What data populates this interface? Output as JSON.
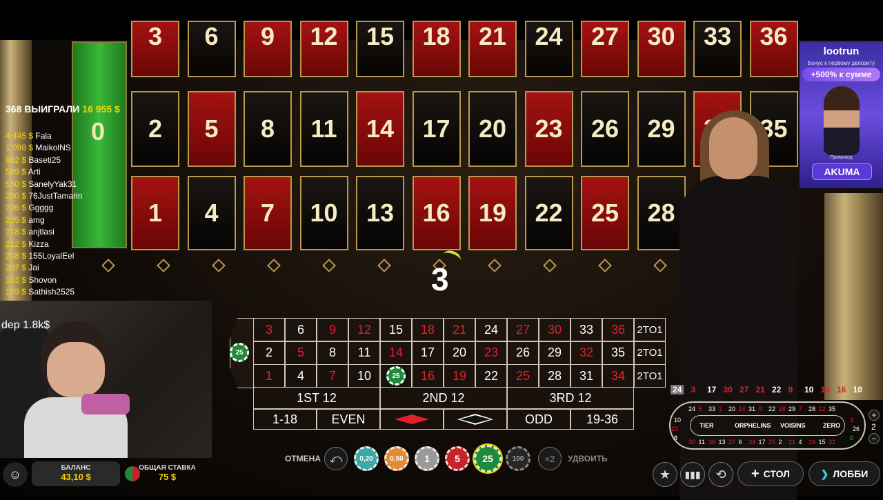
{
  "wall": {
    "zero": "0",
    "top_row": [
      {
        "n": "3",
        "c": "red"
      },
      {
        "n": "6",
        "c": "black"
      },
      {
        "n": "9",
        "c": "red"
      },
      {
        "n": "12",
        "c": "red"
      },
      {
        "n": "15",
        "c": "black"
      },
      {
        "n": "18",
        "c": "red"
      },
      {
        "n": "21",
        "c": "red"
      },
      {
        "n": "24",
        "c": "black"
      },
      {
        "n": "27",
        "c": "red"
      },
      {
        "n": "30",
        "c": "red"
      },
      {
        "n": "33",
        "c": "black"
      },
      {
        "n": "36",
        "c": "red"
      }
    ],
    "mid_row": [
      {
        "n": "2",
        "c": "black"
      },
      {
        "n": "5",
        "c": "red"
      },
      {
        "n": "8",
        "c": "black"
      },
      {
        "n": "11",
        "c": "black"
      },
      {
        "n": "14",
        "c": "red"
      },
      {
        "n": "17",
        "c": "black"
      },
      {
        "n": "20",
        "c": "black"
      },
      {
        "n": "23",
        "c": "red"
      },
      {
        "n": "26",
        "c": "black"
      },
      {
        "n": "29",
        "c": "black"
      },
      {
        "n": "32",
        "c": "red"
      },
      {
        "n": "35",
        "c": "black"
      }
    ],
    "bot_row": [
      {
        "n": "1",
        "c": "red"
      },
      {
        "n": "4",
        "c": "black"
      },
      {
        "n": "7",
        "c": "red"
      },
      {
        "n": "10",
        "c": "black"
      },
      {
        "n": "13",
        "c": "black"
      },
      {
        "n": "16",
        "c": "red"
      },
      {
        "n": "19",
        "c": "red"
      },
      {
        "n": "22",
        "c": "black"
      },
      {
        "n": "25",
        "c": "red"
      },
      {
        "n": "28",
        "c": "black"
      }
    ]
  },
  "result_number": "3",
  "winners": {
    "count": "368",
    "label": "ВЫИГРАЛИ",
    "total": "16 955 $",
    "list": [
      {
        "amount": "4 445 $",
        "name": "Fala"
      },
      {
        "amount": "1 098 $",
        "name": "MaikolNS"
      },
      {
        "amount": "962 $",
        "name": "Baseti25"
      },
      {
        "amount": "589 $",
        "name": "Arti"
      },
      {
        "amount": "550 $",
        "name": "SanelyYak31"
      },
      {
        "amount": "280 $",
        "name": "76JustTamarin"
      },
      {
        "amount": "226 $",
        "name": "Ggggg"
      },
      {
        "amount": "225 $",
        "name": "amg"
      },
      {
        "amount": "218 $",
        "name": "anjtlasi"
      },
      {
        "amount": "212 $",
        "name": "Kizza"
      },
      {
        "amount": "208 $",
        "name": "155LoyalEel"
      },
      {
        "amount": "207 $",
        "name": "Jai"
      },
      {
        "amount": "163 $",
        "name": "Shovon"
      },
      {
        "amount": "159 $",
        "name": "Sathish2525"
      }
    ]
  },
  "bet_table": {
    "zero_chip": "25",
    "rows": [
      [
        {
          "n": "3",
          "c": "r"
        },
        {
          "n": "6",
          "c": "b"
        },
        {
          "n": "9",
          "c": "r"
        },
        {
          "n": "12",
          "c": "r"
        },
        {
          "n": "15",
          "c": "b"
        },
        {
          "n": "18",
          "c": "r"
        },
        {
          "n": "21",
          "c": "r"
        },
        {
          "n": "24",
          "c": "b"
        },
        {
          "n": "27",
          "c": "r"
        },
        {
          "n": "30",
          "c": "r"
        },
        {
          "n": "33",
          "c": "b"
        },
        {
          "n": "36",
          "c": "r"
        }
      ],
      [
        {
          "n": "2",
          "c": "b"
        },
        {
          "n": "5",
          "c": "r"
        },
        {
          "n": "8",
          "c": "b"
        },
        {
          "n": "11",
          "c": "b"
        },
        {
          "n": "14",
          "c": "r"
        },
        {
          "n": "17",
          "c": "b"
        },
        {
          "n": "20",
          "c": "b"
        },
        {
          "n": "23",
          "c": "r"
        },
        {
          "n": "26",
          "c": "b"
        },
        {
          "n": "29",
          "c": "b"
        },
        {
          "n": "32",
          "c": "r"
        },
        {
          "n": "35",
          "c": "b"
        }
      ],
      [
        {
          "n": "1",
          "c": "r"
        },
        {
          "n": "4",
          "c": "b"
        },
        {
          "n": "7",
          "c": "r"
        },
        {
          "n": "10",
          "c": "b"
        },
        {
          "n": "25",
          "c": "chip"
        },
        {
          "n": "16",
          "c": "r"
        },
        {
          "n": "19",
          "c": "r"
        },
        {
          "n": "22",
          "c": "b"
        },
        {
          "n": "25",
          "c": "r"
        },
        {
          "n": "28",
          "c": "b"
        },
        {
          "n": "31",
          "c": "b"
        },
        {
          "n": "34",
          "c": "r"
        }
      ]
    ],
    "column_label": "2TO1",
    "dozens": [
      "1ST 12",
      "2ND 12",
      "3RD 12"
    ],
    "outside": {
      "low": "1-18",
      "even": "EVEN",
      "odd": "ODD",
      "high": "19-36"
    }
  },
  "webcam": {
    "caption": "dep 1.8k$"
  },
  "history": [
    {
      "n": "24",
      "c": "#fff"
    },
    {
      "n": "3",
      "c": "#e3202a"
    },
    {
      "n": "17",
      "c": "#fff"
    },
    {
      "n": "30",
      "c": "#e3202a"
    },
    {
      "n": "27",
      "c": "#e3202a"
    },
    {
      "n": "21",
      "c": "#e3202a"
    },
    {
      "n": "22",
      "c": "#fff"
    },
    {
      "n": "9",
      "c": "#e3202a"
    },
    {
      "n": "10",
      "c": "#fff"
    },
    {
      "n": "18",
      "c": "#e3202a"
    },
    {
      "n": "16",
      "c": "#e3202a"
    },
    {
      "n": "10",
      "c": "#fff"
    }
  ],
  "racetrack": {
    "sections": [
      "TIER",
      "ORPHELINS",
      "VOISINS",
      "ZERO"
    ],
    "top": [
      "24",
      "5",
      "33",
      "1",
      "20",
      "14",
      "31",
      "9",
      "22",
      "18",
      "29",
      "7",
      "28",
      "12",
      "35"
    ],
    "bottom": [
      "30",
      "11",
      "36",
      "13",
      "27",
      "6",
      "34",
      "17",
      "25",
      "2",
      "21",
      "4",
      "19",
      "15",
      "32"
    ],
    "left": [
      "10",
      "23",
      "8"
    ],
    "right": [
      "3",
      "26",
      "0"
    ],
    "neighbours": "2"
  },
  "controls": {
    "cancel": "ОТМЕНА",
    "double": "УДВОИТЬ",
    "double_icon": "×2",
    "chips": [
      {
        "v": "0,20",
        "bg": "#3fa8a6"
      },
      {
        "v": "0,50",
        "bg": "#e08a3a"
      },
      {
        "v": "1",
        "bg": "#9a9a9a"
      },
      {
        "v": "5",
        "bg": "#c9232a"
      },
      {
        "v": "25",
        "bg": "#1e8a3a"
      },
      {
        "v": "100",
        "bg": "#3a3a3a"
      }
    ],
    "table_btn": "СТОЛ",
    "lobby_btn": "ЛОББИ"
  },
  "balance": {
    "label": "БАЛАНС",
    "value": "43,10 $"
  },
  "total_bet": {
    "label": "ОБЩАЯ СТАВКА",
    "value": "75 $"
  },
  "ad": {
    "brand": "lootrun",
    "subtitle": "Бонус к первому депозиту",
    "percent": "+500% к сумме",
    "promo_label": "Промокод",
    "promo_code": "AKUMA"
  }
}
